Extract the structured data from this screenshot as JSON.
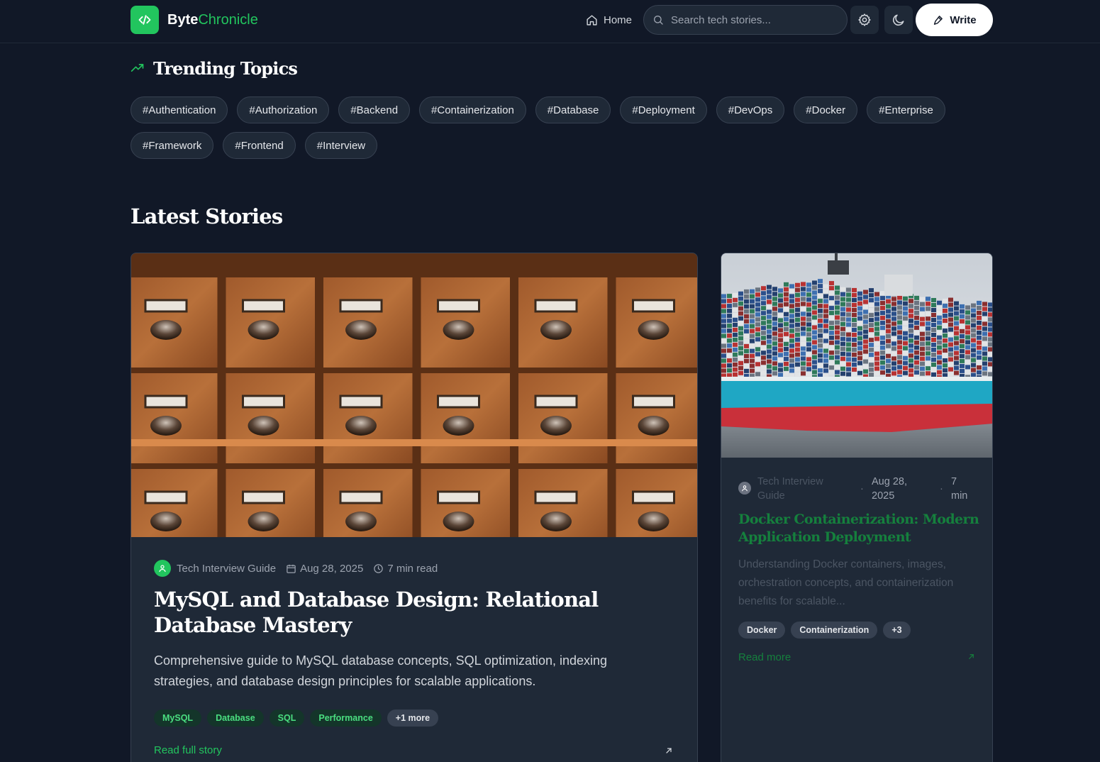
{
  "header": {
    "logo_bold": "Byte",
    "logo_accent": "Chronicle",
    "home_label": "Home",
    "search_placeholder": "Search tech stories...",
    "write_label": "Write",
    "icons": [
      "code-icon",
      "home-icon",
      "search-icon",
      "gear-icon",
      "moon-icon",
      "pen-icon"
    ]
  },
  "trending": {
    "title": "Trending Topics",
    "topics": [
      "#Authentication",
      "#Authorization",
      "#Backend",
      "#Containerization",
      "#Database",
      "#Deployment",
      "#DevOps",
      "#Docker",
      "#Enterprise",
      "#Framework",
      "#Frontend",
      "#Interview"
    ]
  },
  "latest": {
    "title": "Latest Stories",
    "featured": {
      "author": "Tech Interview Guide",
      "date": "Aug 28, 2025",
      "read_time": "7 min read",
      "title": "MySQL and Database Design: Relational Database Mastery",
      "excerpt": "Comprehensive guide to MySQL database concepts, SQL optimization, indexing strategies, and database design principles for scalable applications.",
      "tags": [
        "MySQL",
        "Database",
        "SQL",
        "Performance"
      ],
      "more_tags": "+1 more",
      "read_label": "Read full story"
    },
    "side": {
      "author": "Tech Interview Guide",
      "date": "Aug 28, 2025",
      "read_time": "7 min",
      "title": "Docker Containerization: Modern Application Deployment",
      "excerpt": "Understanding Docker containers, images, orchestration concepts, and containerization benefits for scalable...",
      "tags": [
        "Docker",
        "Containerization"
      ],
      "more_tags": "+3",
      "read_label": "Read more"
    }
  },
  "colors": {
    "background": "#111827",
    "card": "#1f2937",
    "accent": "#22c55e",
    "border": "#374151"
  }
}
